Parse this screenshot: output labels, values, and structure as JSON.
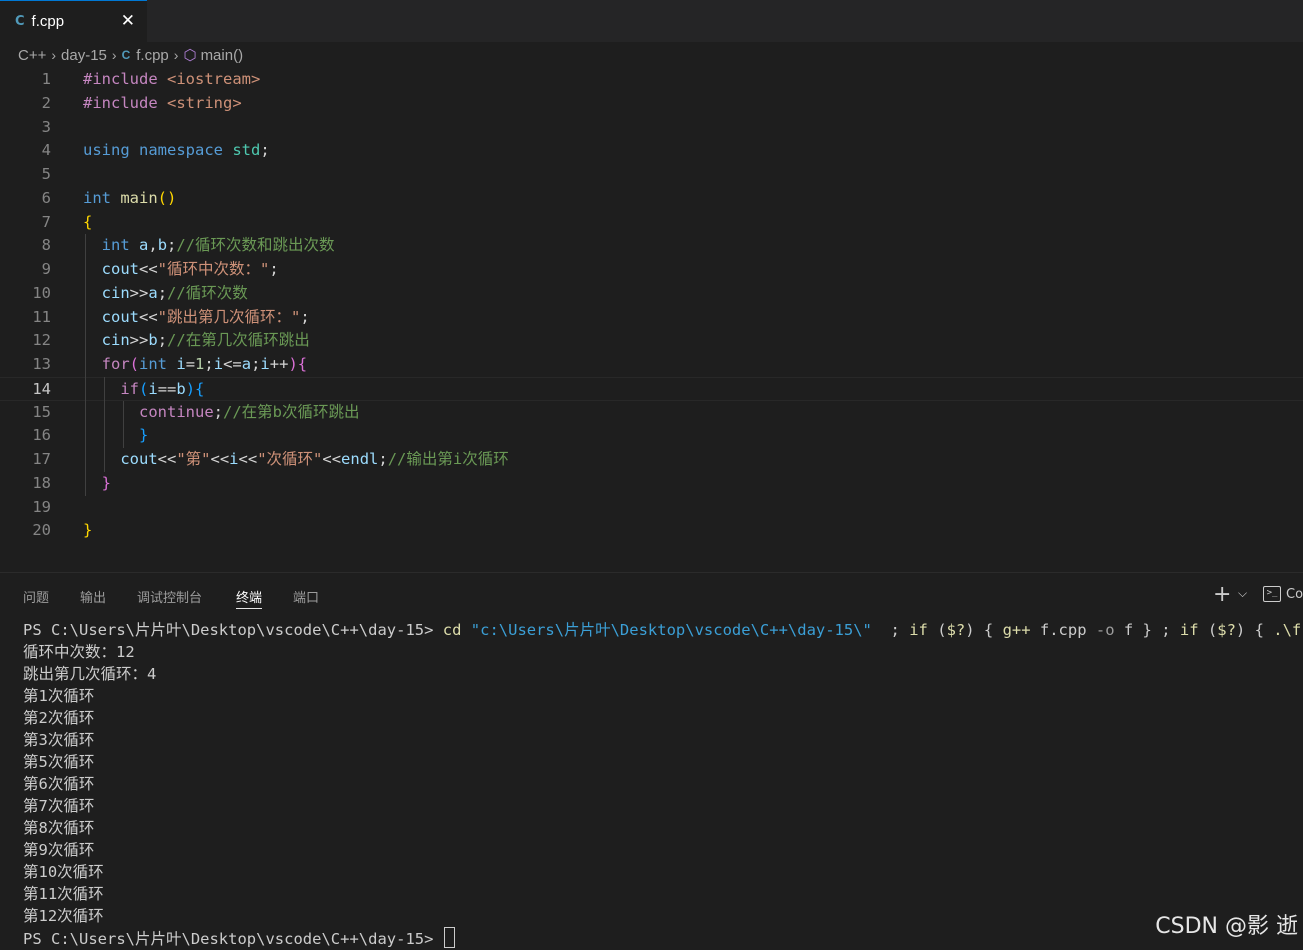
{
  "tab": {
    "cpp_badge": "C",
    "label": "f.cpp",
    "close": "✕"
  },
  "breadcrumb": {
    "root": "C++",
    "folder": "day-15",
    "file": "f.cpp",
    "symbol": "main()"
  },
  "editor": {
    "current_line": 14,
    "lines": [
      {
        "n": "1",
        "t": [
          [
            "k-pre",
            "#include "
          ],
          [
            "k-inc",
            "<iostream>"
          ]
        ]
      },
      {
        "n": "2",
        "t": [
          [
            "k-pre",
            "#include "
          ],
          [
            "k-inc",
            "<string>"
          ]
        ]
      },
      {
        "n": "3",
        "t": []
      },
      {
        "n": "4",
        "t": [
          [
            "k-kw",
            "using "
          ],
          [
            "k-kw",
            "namespace "
          ],
          [
            "k-ns",
            "std"
          ],
          [
            "k-pun",
            ";"
          ]
        ]
      },
      {
        "n": "5",
        "t": []
      },
      {
        "n": "6",
        "t": [
          [
            "k-kw",
            "int "
          ],
          [
            "k-fn",
            "main"
          ],
          [
            "k-b1",
            "()"
          ]
        ]
      },
      {
        "n": "7",
        "t": [
          [
            "k-b1",
            "{"
          ]
        ]
      },
      {
        "n": "8",
        "t": [
          [
            "k-pun",
            "  "
          ],
          [
            "k-kw",
            "int "
          ],
          [
            "k-var",
            "a"
          ],
          [
            "k-pun",
            ","
          ],
          [
            "k-var",
            "b"
          ],
          [
            "k-pun",
            ";"
          ],
          [
            "k-com",
            "//循环次数和跳出次数"
          ]
        ]
      },
      {
        "n": "9",
        "t": [
          [
            "k-pun",
            "  "
          ],
          [
            "k-var",
            "cout"
          ],
          [
            "k-pun",
            "<<"
          ],
          [
            "k-str",
            "\"循环中次数：\""
          ],
          [
            "k-pun",
            ";"
          ]
        ]
      },
      {
        "n": "10",
        "t": [
          [
            "k-pun",
            "  "
          ],
          [
            "k-var",
            "cin"
          ],
          [
            "k-pun",
            ">>"
          ],
          [
            "k-var",
            "a"
          ],
          [
            "k-pun",
            ";"
          ],
          [
            "k-com",
            "//循环次数"
          ]
        ]
      },
      {
        "n": "11",
        "t": [
          [
            "k-pun",
            "  "
          ],
          [
            "k-var",
            "cout"
          ],
          [
            "k-pun",
            "<<"
          ],
          [
            "k-str",
            "\"跳出第几次循环：\""
          ],
          [
            "k-pun",
            ";"
          ]
        ]
      },
      {
        "n": "12",
        "t": [
          [
            "k-pun",
            "  "
          ],
          [
            "k-var",
            "cin"
          ],
          [
            "k-pun",
            ">>"
          ],
          [
            "k-var",
            "b"
          ],
          [
            "k-pun",
            ";"
          ],
          [
            "k-com",
            "//在第几次循环跳出"
          ]
        ]
      },
      {
        "n": "13",
        "t": [
          [
            "k-pun",
            "  "
          ],
          [
            "k-ctl",
            "for"
          ],
          [
            "k-b2",
            "("
          ],
          [
            "k-kw",
            "int "
          ],
          [
            "k-var",
            "i"
          ],
          [
            "k-pun",
            "="
          ],
          [
            "k-num",
            "1"
          ],
          [
            "k-pun",
            ";"
          ],
          [
            "k-var",
            "i"
          ],
          [
            "k-pun",
            "<="
          ],
          [
            "k-var",
            "a"
          ],
          [
            "k-pun",
            ";"
          ],
          [
            "k-var",
            "i"
          ],
          [
            "k-pun",
            "++"
          ],
          [
            "k-b2",
            ")"
          ],
          [
            "k-b2",
            "{"
          ]
        ]
      },
      {
        "n": "14",
        "t": [
          [
            "k-pun",
            "    "
          ],
          [
            "k-ctl",
            "if"
          ],
          [
            "k-b3",
            "("
          ],
          [
            "k-var",
            "i"
          ],
          [
            "k-pun",
            "=="
          ],
          [
            "k-var",
            "b"
          ],
          [
            "k-b3",
            ")"
          ],
          [
            "k-b3",
            "{"
          ]
        ]
      },
      {
        "n": "15",
        "t": [
          [
            "k-pun",
            "      "
          ],
          [
            "k-ctl",
            "continue"
          ],
          [
            "k-pun",
            ";"
          ],
          [
            "k-com",
            "//在第b次循环跳出"
          ]
        ]
      },
      {
        "n": "16",
        "t": [
          [
            "k-pun",
            "      "
          ],
          [
            "k-b3",
            "}"
          ]
        ]
      },
      {
        "n": "17",
        "t": [
          [
            "k-pun",
            "    "
          ],
          [
            "k-var",
            "cout"
          ],
          [
            "k-pun",
            "<<"
          ],
          [
            "k-str",
            "\"第\""
          ],
          [
            "k-pun",
            "<<"
          ],
          [
            "k-var",
            "i"
          ],
          [
            "k-pun",
            "<<"
          ],
          [
            "k-str",
            "\"次循环\""
          ],
          [
            "k-pun",
            "<<"
          ],
          [
            "k-var",
            "endl"
          ],
          [
            "k-pun",
            ";"
          ],
          [
            "k-com",
            "//输出第i次循环"
          ]
        ]
      },
      {
        "n": "18",
        "t": [
          [
            "k-pun",
            "  "
          ],
          [
            "k-b2",
            "}"
          ]
        ]
      },
      {
        "n": "19",
        "t": []
      },
      {
        "n": "20",
        "t": [
          [
            "k-b1",
            "}"
          ]
        ]
      }
    ]
  },
  "panel": {
    "tabs": [
      "问题",
      "输出",
      "调试控制台",
      "终端",
      "端口"
    ],
    "active_tab": "终端",
    "new_terminal": "+",
    "dropdown": "⌵",
    "terminal_glyph": ">_",
    "terminal_label": "Co"
  },
  "terminal": {
    "prompt": "PS C:\\Users\\片片叶\\Desktop\\vscode\\C++\\day-15> ",
    "command_parts": [
      [
        "t-cmd",
        "cd "
      ],
      [
        "t-str",
        "\"c:\\Users\\片片叶\\Desktop\\vscode\\C++\\day-15\\\""
      ],
      [
        "",
        "  ; "
      ],
      [
        "t-kw",
        "if "
      ],
      [
        "",
        "("
      ],
      [
        "t-kw",
        "$?"
      ],
      [
        "",
        ") { "
      ],
      [
        "t-cmd",
        "g++ "
      ],
      [
        "",
        "f.cpp "
      ],
      [
        "t-par",
        "-o "
      ],
      [
        "",
        "f } ; "
      ],
      [
        "t-kw",
        "if "
      ],
      [
        "",
        "("
      ],
      [
        "t-kw",
        "$?"
      ],
      [
        "",
        ") { "
      ],
      [
        "t-cmd",
        ".\\f"
      ],
      [
        "",
        " }"
      ]
    ],
    "output": [
      "循环中次数：12",
      "跳出第几次循环：4",
      "第1次循环",
      "第2次循环",
      "第3次循环",
      "第5次循环",
      "第6次循环",
      "第7次循环",
      "第8次循环",
      "第9次循环",
      "第10次循环",
      "第11次循环",
      "第12次循环"
    ],
    "final_prompt": "PS C:\\Users\\片片叶\\Desktop\\vscode\\C++\\day-15> "
  },
  "watermark": "CSDN @影 逝"
}
